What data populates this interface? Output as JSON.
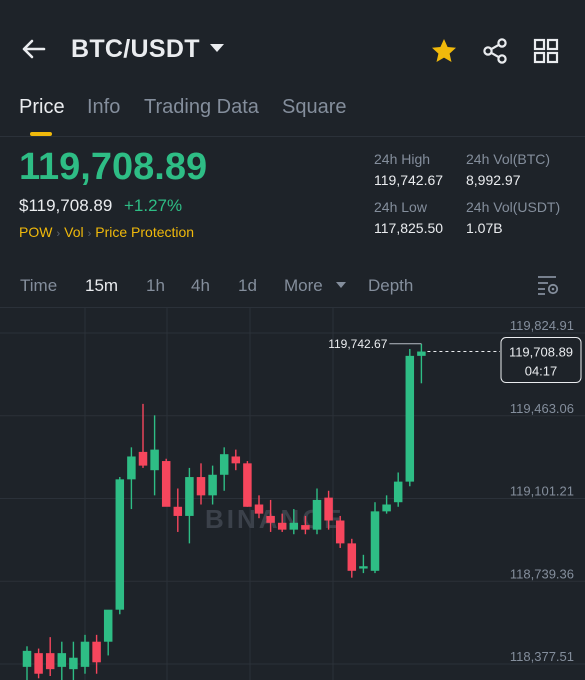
{
  "header": {
    "pair": "BTC/USDT",
    "icons": [
      "back-arrow-icon",
      "dropdown-caret-icon",
      "star-icon",
      "share-icon",
      "grid-icon"
    ],
    "favorite_color": "#f0b90b"
  },
  "tabs": [
    {
      "label": "Price",
      "active": true
    },
    {
      "label": "Info"
    },
    {
      "label": "Trading Data"
    },
    {
      "label": "Square"
    }
  ],
  "ticker": {
    "last_price": "119,708.89",
    "usd_price": "$119,708.89",
    "change": "+1.27%",
    "tags": [
      "POW",
      "Vol",
      "Price Protection"
    ],
    "up_color": "#2ebd85",
    "down_color": "#f6465d"
  },
  "stats": {
    "high_label": "24h High",
    "high_value": "119,742.67",
    "vol_btc_label": "24h Vol(BTC)",
    "vol_btc_value": "8,992.97",
    "low_label": "24h Low",
    "low_value": "117,825.50",
    "vol_usdt_label": "24h Vol(USDT)",
    "vol_usdt_value": "1.07B"
  },
  "intervals": [
    {
      "label": "Time"
    },
    {
      "label": "15m",
      "active": true
    },
    {
      "label": "1h"
    },
    {
      "label": "4h"
    },
    {
      "label": "1d"
    },
    {
      "label": "More"
    },
    {
      "label": "Depth"
    }
  ],
  "chart_data": {
    "type": "candlestick",
    "y_ticks": [
      119824.91,
      119463.06,
      119101.21,
      118739.36,
      118377.51
    ],
    "y_tick_labels": [
      "119,824.91",
      "119,463.06",
      "119,101.21",
      "118,739.36",
      "118,377.51"
    ],
    "high_marker": "119,742.67",
    "current_price_label": "119,708.89",
    "countdown": "04:17",
    "watermark": "BINANCE",
    "candles": [
      {
        "o": 118330,
        "h": 118420,
        "l": 118250,
        "c": 118400
      },
      {
        "o": 118390,
        "h": 118410,
        "l": 118280,
        "c": 118300
      },
      {
        "o": 118390,
        "h": 118460,
        "l": 118290,
        "c": 118320
      },
      {
        "o": 118330,
        "h": 118440,
        "l": 118260,
        "c": 118390
      },
      {
        "o": 118320,
        "h": 118440,
        "l": 118250,
        "c": 118370
      },
      {
        "o": 118330,
        "h": 118470,
        "l": 118300,
        "c": 118440
      },
      {
        "o": 118440,
        "h": 118470,
        "l": 118300,
        "c": 118350
      },
      {
        "o": 118440,
        "h": 118510,
        "l": 118380,
        "c": 118580
      },
      {
        "o": 118580,
        "h": 119160,
        "l": 118560,
        "c": 119150
      },
      {
        "o": 119150,
        "h": 119290,
        "l": 119020,
        "c": 119250
      },
      {
        "o": 119270,
        "h": 119480,
        "l": 119200,
        "c": 119210
      },
      {
        "o": 119190,
        "h": 119430,
        "l": 119080,
        "c": 119280
      },
      {
        "o": 119230,
        "h": 119240,
        "l": 119060,
        "c": 119030
      },
      {
        "o": 119030,
        "h": 119110,
        "l": 118920,
        "c": 118990
      },
      {
        "o": 118990,
        "h": 119200,
        "l": 118870,
        "c": 119160
      },
      {
        "o": 119160,
        "h": 119220,
        "l": 119040,
        "c": 119080
      },
      {
        "o": 119080,
        "h": 119210,
        "l": 119040,
        "c": 119170
      },
      {
        "o": 119170,
        "h": 119290,
        "l": 119100,
        "c": 119260
      },
      {
        "o": 119250,
        "h": 119280,
        "l": 119190,
        "c": 119220
      },
      {
        "o": 119220,
        "h": 119230,
        "l": 119030,
        "c": 119030
      },
      {
        "o": 119040,
        "h": 119080,
        "l": 118980,
        "c": 119000
      },
      {
        "o": 118990,
        "h": 119060,
        "l": 118920,
        "c": 118960
      },
      {
        "o": 118960,
        "h": 119000,
        "l": 118920,
        "c": 118930
      },
      {
        "o": 118930,
        "h": 119020,
        "l": 118910,
        "c": 118960
      },
      {
        "o": 118950,
        "h": 118990,
        "l": 118910,
        "c": 118930
      },
      {
        "o": 118930,
        "h": 119110,
        "l": 118910,
        "c": 119060
      },
      {
        "o": 119070,
        "h": 119100,
        "l": 118930,
        "c": 118970
      },
      {
        "o": 118970,
        "h": 118990,
        "l": 118850,
        "c": 118870
      },
      {
        "o": 118870,
        "h": 118890,
        "l": 118720,
        "c": 118750
      },
      {
        "o": 118760,
        "h": 118820,
        "l": 118740,
        "c": 118770
      },
      {
        "o": 118750,
        "h": 119050,
        "l": 118740,
        "c": 119010
      },
      {
        "o": 119010,
        "h": 119080,
        "l": 119000,
        "c": 119040
      },
      {
        "o": 119050,
        "h": 119180,
        "l": 119030,
        "c": 119140
      },
      {
        "o": 119140,
        "h": 119720,
        "l": 119120,
        "c": 119690
      },
      {
        "o": 119690,
        "h": 119742.67,
        "l": 119570,
        "c": 119708.89
      }
    ]
  }
}
